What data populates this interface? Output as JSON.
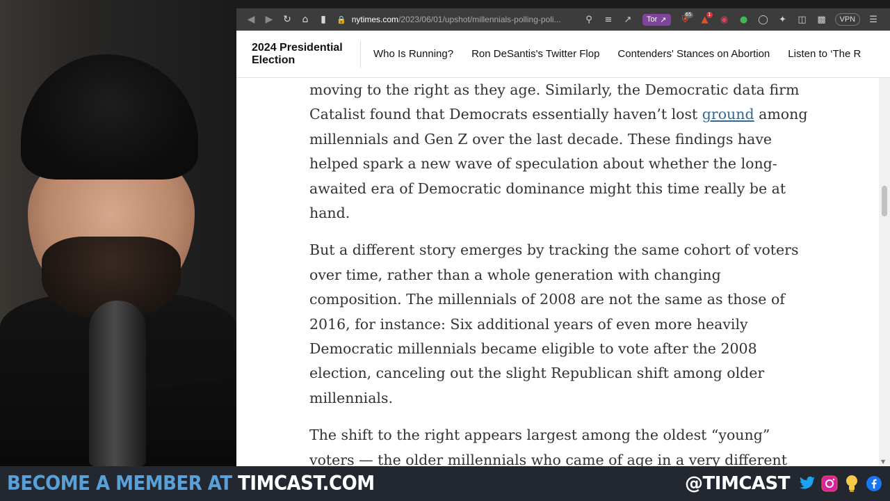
{
  "browser": {
    "url_host": "nytimes.com",
    "url_path": "/2023/06/01/upshot/millennials-polling-poli...",
    "tor_label": "Tor",
    "brave_count": "65",
    "alert_count": "1",
    "vpn_label": "VPN"
  },
  "header": {
    "section_title": "2024 Presidential Election",
    "nav": [
      "Who Is Running?",
      "Ron DeSantis's Twitter Flop",
      "Contenders' Stances on Abortion",
      "Listen to ‘The R"
    ]
  },
  "article": {
    "p1_before": "moving to the right as they age. Similarly, the Democratic data firm Catalist found that Democrats essentially haven’t lost ",
    "p1_link": "ground",
    "p1_after": " among millennials and Gen Z over the last decade. These findings have helped spark a new wave of speculation about whether the long-awaited era of Democratic dominance might this time really be at hand.",
    "p2": "But a different story emerges by tracking the same cohort of voters over time, rather than a whole generation with changing composition. The millennials of 2008 are not the same as those of 2016, for instance: Six additional years of even more heavily Democratic millennials became eligible to vote after the 2008 election, canceling out the slight Republican shift among older millennials.",
    "p3": "The shift to the right appears largest among the oldest “young” voters — the older millennials who came of age in a very different"
  },
  "banner": {
    "left_a": "BECOME A MEMBER AT ",
    "left_b": "TIMCAST.COM",
    "handle": "@TIMCAST"
  },
  "colors": {
    "banner_bg": "#222730",
    "banner_accent": "#5aa0d8",
    "link": "#326891",
    "tor": "#7d4698"
  },
  "icons": [
    "back-icon",
    "forward-icon",
    "reload-icon",
    "home-icon",
    "bookmark-icon",
    "lock-icon",
    "zoom-icon",
    "reader-icon",
    "share-icon",
    "brave-shield-icon",
    "rewards-icon",
    "extension-icon",
    "puzzle-icon",
    "sidebar-icon",
    "wallet-icon",
    "menu-icon",
    "twitter-icon",
    "instagram-icon",
    "lightbulb-icon",
    "facebook-icon"
  ]
}
